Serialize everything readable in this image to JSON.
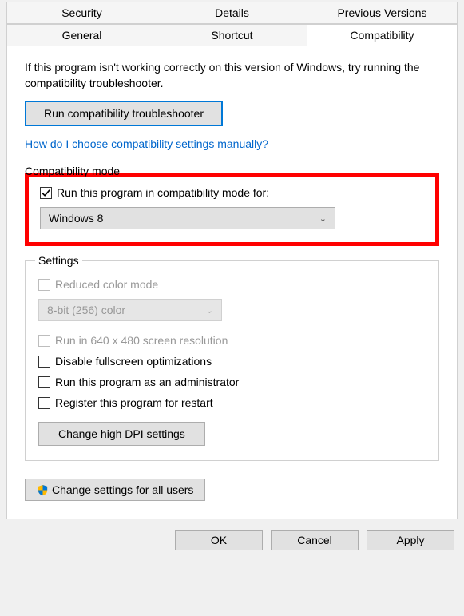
{
  "tabs": {
    "row1": [
      "Security",
      "Details",
      "Previous Versions"
    ],
    "row2": [
      "General",
      "Shortcut",
      "Compatibility"
    ],
    "active": "Compatibility"
  },
  "intro": "If this program isn't working correctly on this version of Windows, try running the compatibility troubleshooter.",
  "buttons": {
    "troubleshooter": "Run compatibility troubleshooter",
    "dpi": "Change high DPI settings",
    "all_users": "Change settings for all users",
    "ok": "OK",
    "cancel": "Cancel",
    "apply": "Apply"
  },
  "link_manual": "How do I choose compatibility settings manually?",
  "compat_mode": {
    "legend": "Compatibility mode",
    "checkbox_label": "Run this program in compatibility mode for:",
    "checked": true,
    "selected": "Windows 8"
  },
  "settings": {
    "legend": "Settings",
    "reduced_color": {
      "label": "Reduced color mode",
      "checked": false,
      "enabled": false
    },
    "color_select": {
      "selected": "8-bit (256) color",
      "enabled": false
    },
    "low_res": {
      "label": "Run in 640 x 480 screen resolution",
      "checked": false,
      "enabled": false
    },
    "disable_fullscreen": {
      "label": "Disable fullscreen optimizations",
      "checked": false
    },
    "run_admin": {
      "label": "Run this program as an administrator",
      "checked": false
    },
    "register_restart": {
      "label": "Register this program for restart",
      "checked": false
    }
  }
}
